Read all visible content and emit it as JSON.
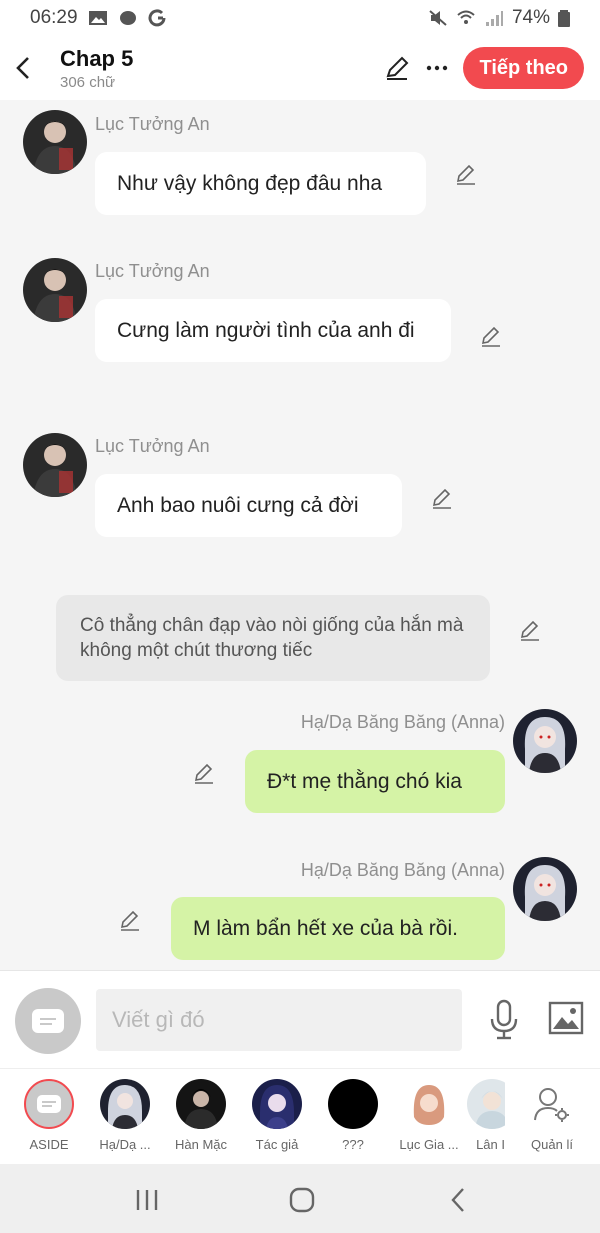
{
  "status_bar": {
    "time": "06:29",
    "battery": "74%"
  },
  "header": {
    "title": "Chap 5",
    "subtitle": "306 chữ",
    "next_label": "Tiếp theo"
  },
  "messages": [
    {
      "sender": "Lục Tưởng An",
      "text": "Như vậy không đẹp đâu nha"
    },
    {
      "sender": "Lục Tưởng An",
      "text": "Cưng làm người tình của anh đi"
    },
    {
      "sender": "Lục Tưởng An",
      "text": "Anh bao nuôi cưng cả đời"
    },
    {
      "narration": "Cô thẳng chân đạp vào nòi giống của hắn mà không một chút thương tiếc"
    },
    {
      "sender": "Hạ/Dạ Băng Băng (Anna)",
      "text": "Đ*t mẹ thằng chó kia"
    },
    {
      "sender": "Hạ/Dạ Băng Băng (Anna)",
      "text": "M làm bẩn hết xe của bà rồi."
    }
  ],
  "composer": {
    "placeholder": "Viết gì đó"
  },
  "characters": [
    {
      "label": "ASIDE"
    },
    {
      "label": "Hạ/Dạ ..."
    },
    {
      "label": "Hàn Mặc"
    },
    {
      "label": "Tác giả"
    },
    {
      "label": "???"
    },
    {
      "label": "Lục Gia ..."
    },
    {
      "label": "Lân I"
    },
    {
      "label": "Quản lí"
    }
  ],
  "colors": {
    "accent": "#f24a4f",
    "green_bubble": "#d5f3a6",
    "background": "#f5f5f5"
  }
}
